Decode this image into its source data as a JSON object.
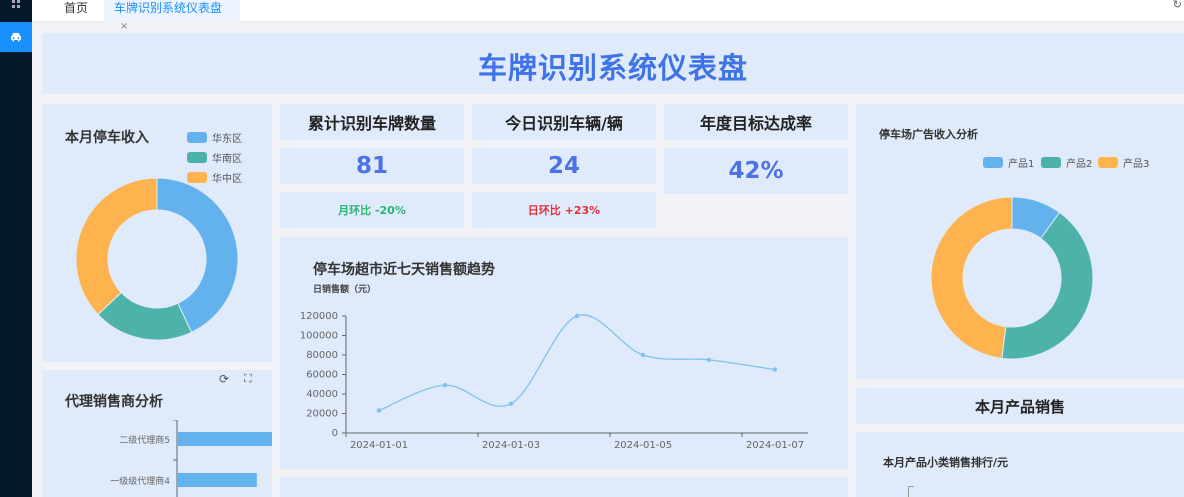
{
  "sidebar": {
    "top_icon": "grid-icon",
    "active_icon": "car-icon"
  },
  "tabs": [
    {
      "label": "首页"
    },
    {
      "label": "车牌识别系统仪表盘",
      "close": "×"
    }
  ],
  "title": "车牌识别系统仪表盘",
  "parking_income": {
    "title": "本月停车收入",
    "legend": [
      {
        "label": "华东区",
        "color": "#63b2ee"
      },
      {
        "label": "华南区",
        "color": "#4db2aa"
      },
      {
        "label": "华中区",
        "color": "#ffb34f"
      }
    ],
    "chart_data": {
      "type": "pie",
      "donut": true,
      "legend_position": "top-right",
      "slices": [
        {
          "label": "华东区",
          "value": 43
        },
        {
          "label": "华南区",
          "value": 20
        },
        {
          "label": "华中区",
          "value": 37
        }
      ]
    }
  },
  "kpis": [
    {
      "title": "累计识别车牌数量",
      "value": "81",
      "compare": "月环比 -20%",
      "compare_color": "#2bb673"
    },
    {
      "title": "今日识别车辆/辆",
      "value": "24",
      "compare": "日环比 +23%",
      "compare_color": "#e0323c"
    },
    {
      "title": "年度目标达成率",
      "value": "42%"
    }
  ],
  "sales_trend": {
    "title": "停车场超市近七天销售额趋势",
    "subtitle": "日销售额（元）",
    "chart_data": {
      "type": "line",
      "smooth": true,
      "x": [
        "2024-01-01",
        "2024-01-02",
        "2024-01-03",
        "2024-01-04",
        "2024-01-05",
        "2024-01-06",
        "2024-01-07"
      ],
      "x_tick_labels": [
        "2024-01-01",
        "2024-01-03",
        "2024-01-05",
        "2024-01-07"
      ],
      "values": [
        23000,
        49000,
        30000,
        120000,
        80000,
        75000,
        65000
      ],
      "ylim": [
        0,
        120000
      ],
      "yticks": [
        0,
        20000,
        40000,
        60000,
        80000,
        100000,
        120000
      ],
      "color": "#7cc3ee"
    }
  },
  "dealer": {
    "title": "代理销售商分析",
    "tools": {
      "refresh": "⟳",
      "expand": "⛶"
    },
    "chart_data": {
      "type": "bar",
      "orientation": "horizontal",
      "categories": [
        "二级代理商5",
        "一级级代理商4"
      ],
      "values": [
        100,
        70
      ],
      "xlim": [
        0,
        100
      ]
    }
  },
  "ad_income": {
    "title": "停车场广告收入分析",
    "legend": [
      {
        "label": "产品1",
        "color": "#63b2ee"
      },
      {
        "label": "产品2",
        "color": "#4db2aa"
      },
      {
        "label": "产品3",
        "color": "#ffb34f"
      }
    ],
    "chart_data": {
      "type": "pie",
      "donut": true,
      "legend_position": "top-right",
      "slices": [
        {
          "label": "产品1",
          "value": 10
        },
        {
          "label": "产品2",
          "value": 42
        },
        {
          "label": "产品3",
          "value": 48
        }
      ]
    }
  },
  "product_sales": {
    "title": "本月产品销售",
    "subtitle": "本月产品小类销售排行/元"
  }
}
